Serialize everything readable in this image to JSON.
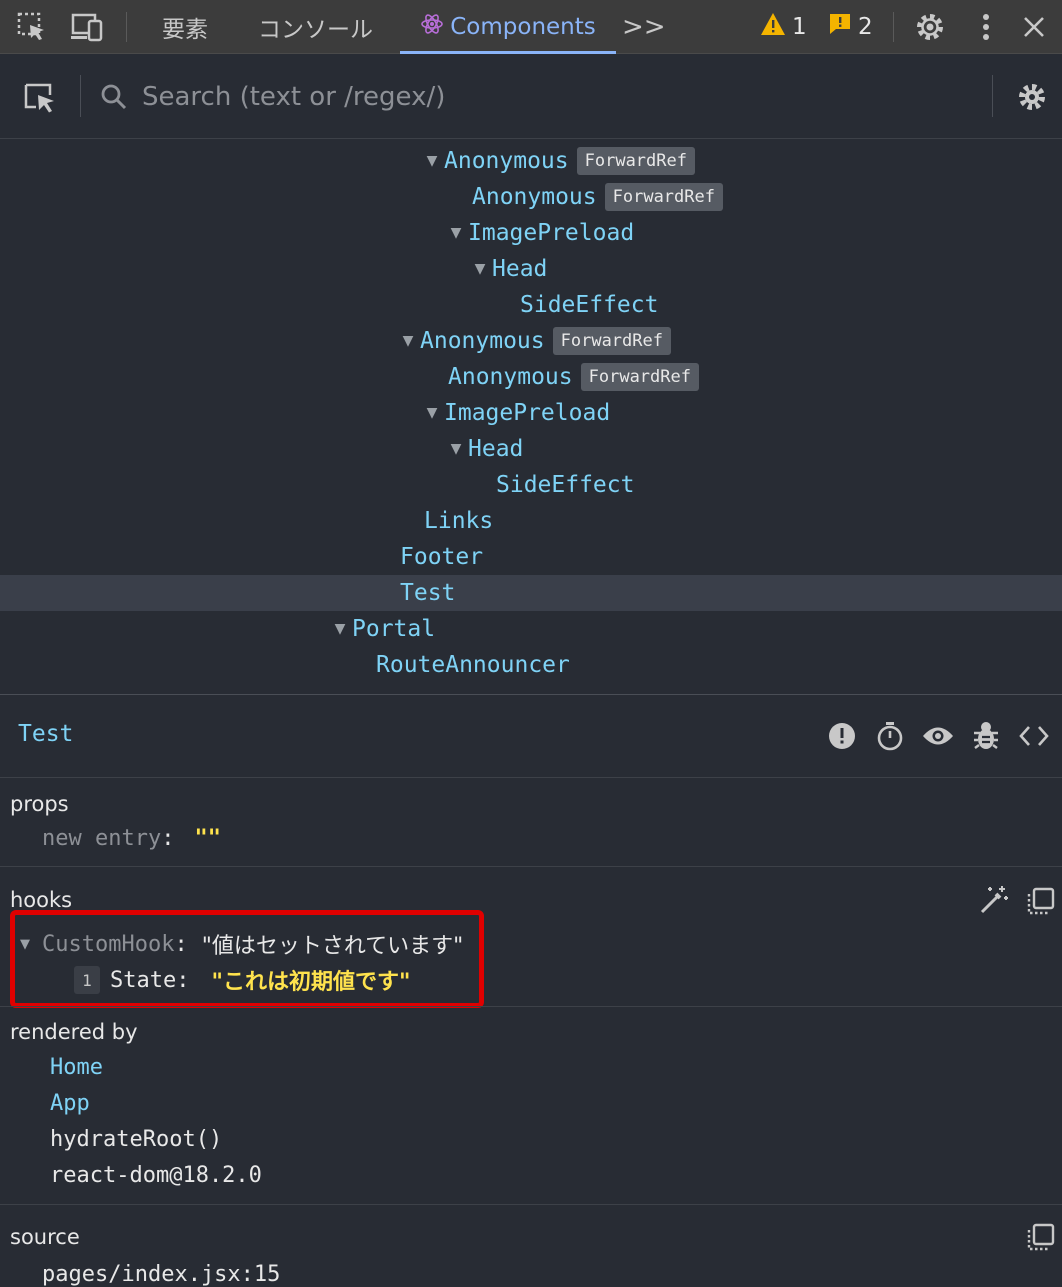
{
  "topbar": {
    "tabs": [
      {
        "label": "要素",
        "active": false
      },
      {
        "label": "コンソール",
        "active": false
      },
      {
        "label": "Components",
        "active": true
      }
    ],
    "more_label": ">>",
    "warnings_count": "1",
    "issues_count": "2",
    "accent_color": "#8ab4f8"
  },
  "search": {
    "placeholder": "Search (text or /regex/)"
  },
  "tree": [
    {
      "name": "Anonymous",
      "tag": "ForwardRef",
      "expanded": true
    },
    {
      "name": "Anonymous",
      "tag": "ForwardRef"
    },
    {
      "name": "ImagePreload",
      "expanded": true
    },
    {
      "name": "Head",
      "expanded": true
    },
    {
      "name": "SideEffect"
    },
    {
      "name": "Anonymous",
      "tag": "ForwardRef",
      "expanded": true
    },
    {
      "name": "Anonymous",
      "tag": "ForwardRef"
    },
    {
      "name": "ImagePreload",
      "expanded": true
    },
    {
      "name": "Head",
      "expanded": true
    },
    {
      "name": "SideEffect"
    },
    {
      "name": "Links"
    },
    {
      "name": "Footer"
    },
    {
      "name": "Test",
      "selected": true
    },
    {
      "name": "Portal",
      "expanded": true
    },
    {
      "name": "RouteAnnouncer"
    }
  ],
  "inspector": {
    "title": "Test",
    "props": {
      "label": "props",
      "entry_key": "new entry",
      "entry_value": "\"\""
    },
    "hooks": {
      "label": "hooks",
      "custom_hook_name": "CustomHook",
      "custom_hook_value": "\"値はセットされています\"",
      "state_index": "1",
      "state_key": "State",
      "state_value": "\"これは初期値です\"",
      "highlight_color": "#e00000"
    },
    "rendered_by": {
      "label": "rendered by",
      "items": [
        "Home",
        "App",
        "hydrateRoot()",
        "react-dom@18.2.0"
      ]
    },
    "source": {
      "label": "source",
      "file": "pages/index.jsx:15"
    }
  }
}
